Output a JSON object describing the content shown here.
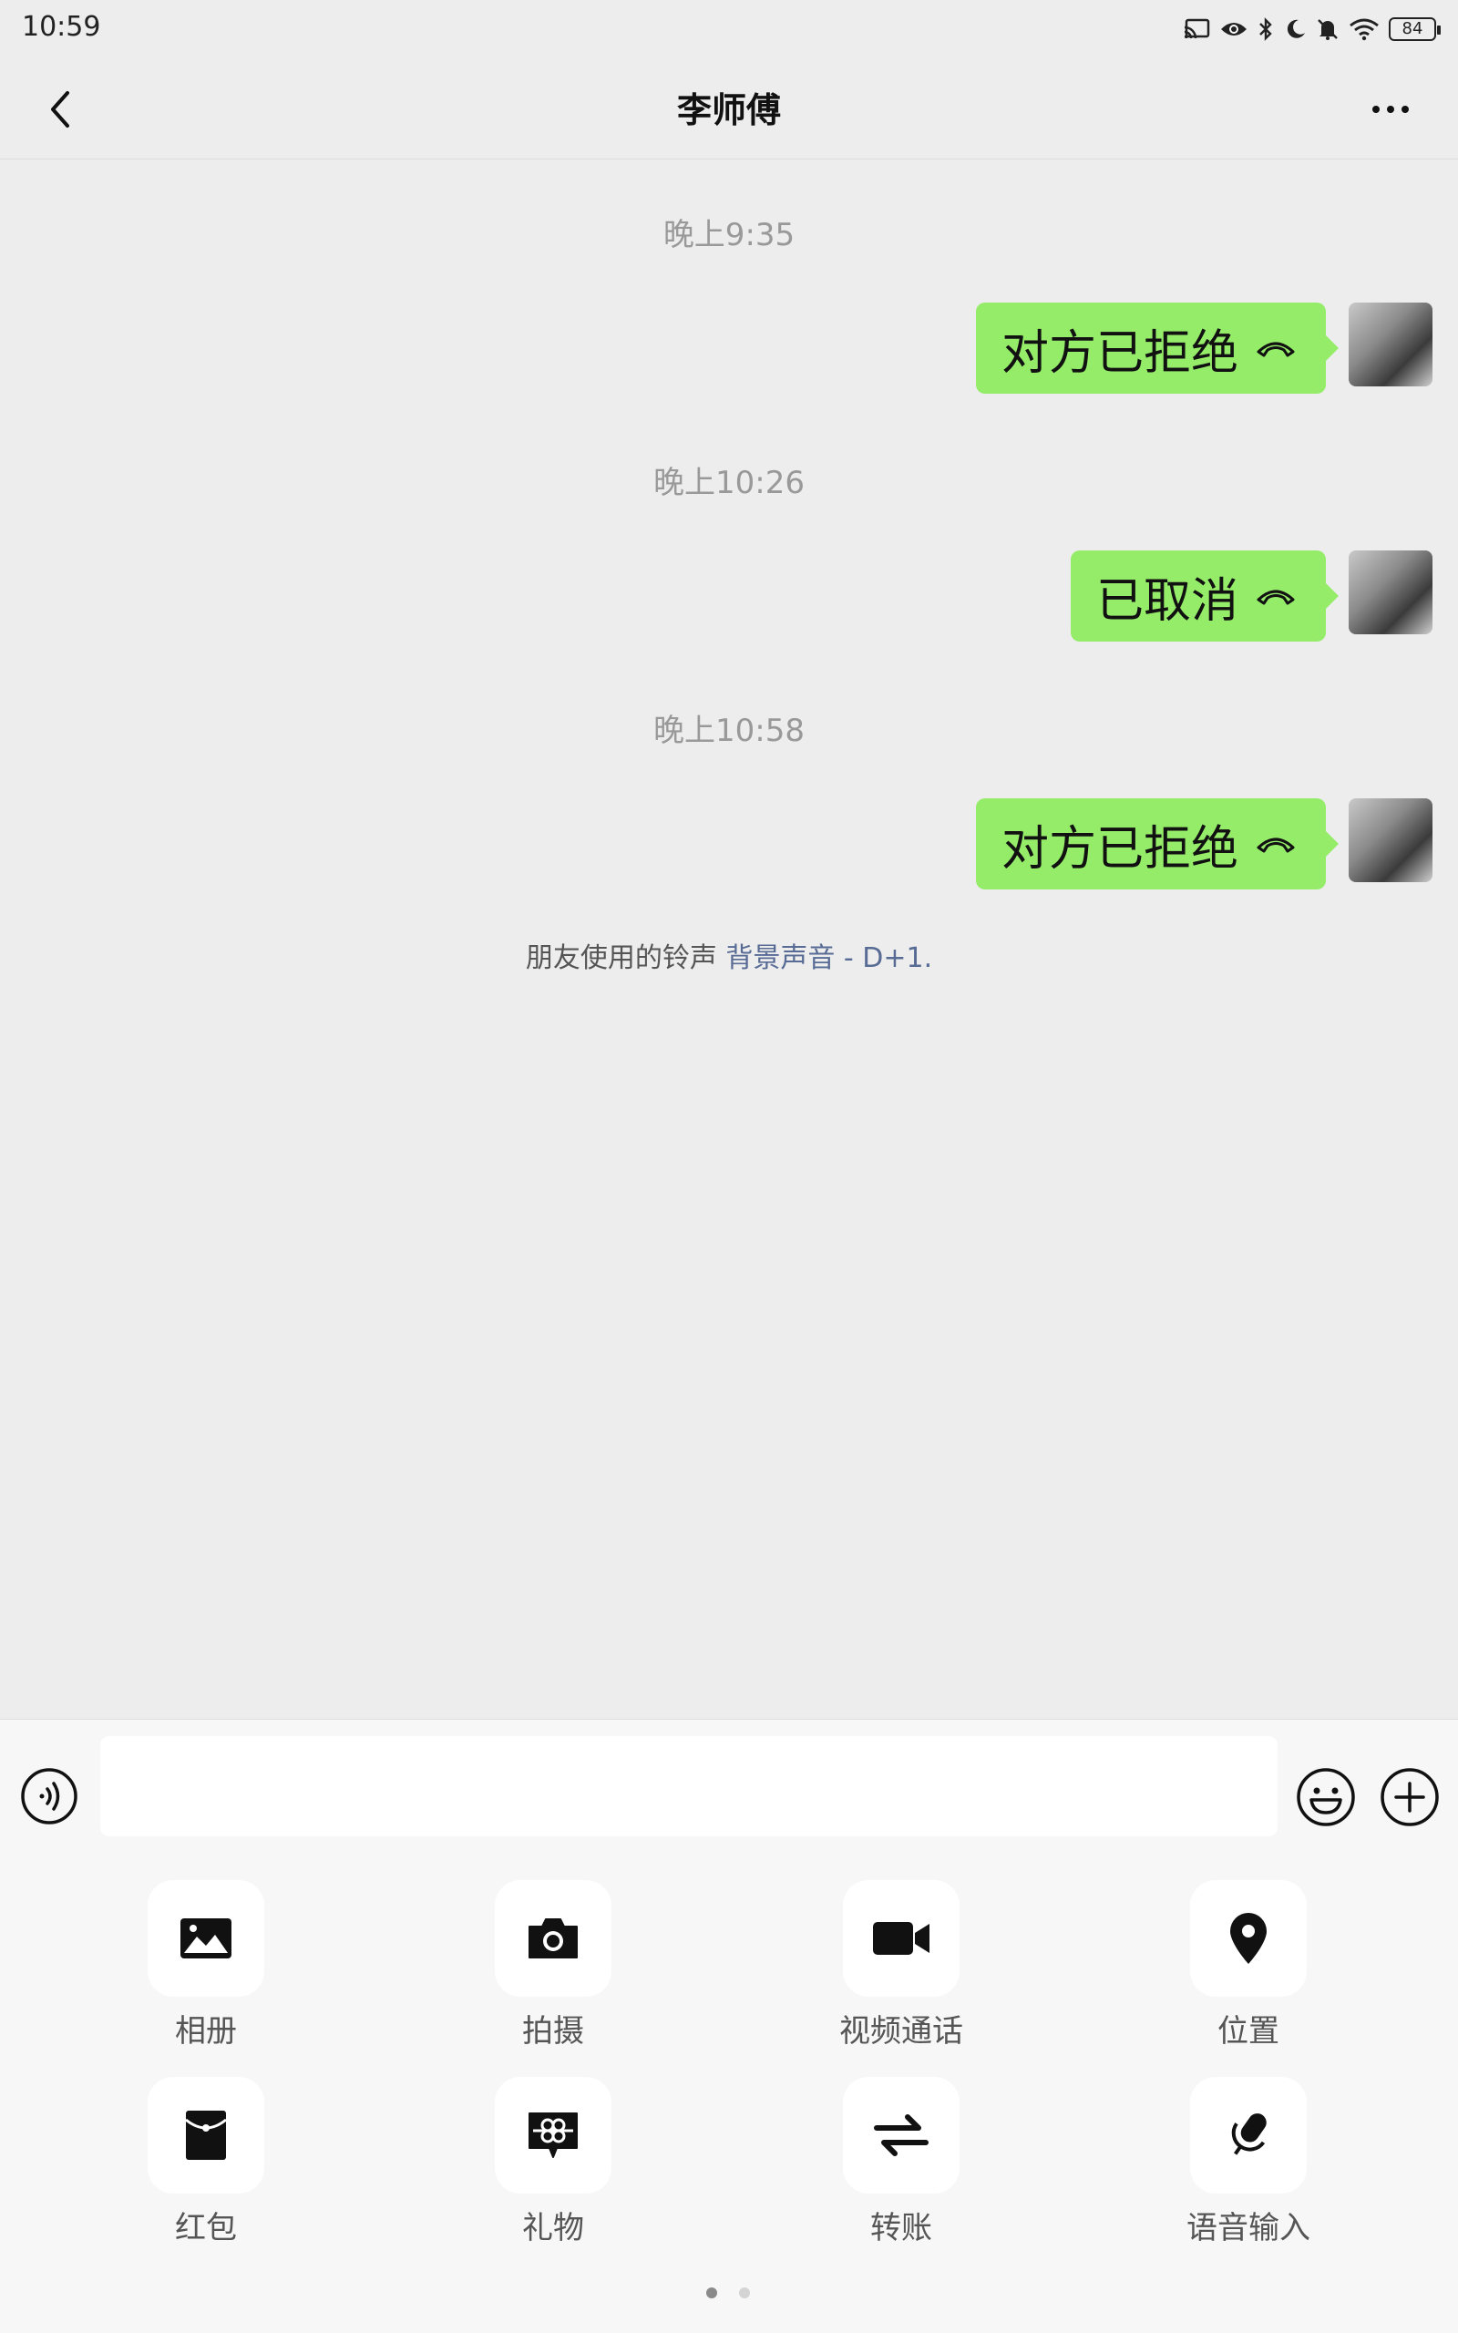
{
  "status_bar": {
    "time": "10:59",
    "battery": "84",
    "icons": [
      "cast-icon",
      "eye-icon",
      "bluetooth-icon",
      "moon-icon",
      "mute-bell-icon",
      "wifi-icon",
      "battery-icon"
    ]
  },
  "header": {
    "title": "李师傅",
    "back_icon": "chevron-left-icon",
    "more_icon": "more-dots-icon"
  },
  "messages": [
    {
      "timestamp": "晚上9:35",
      "text": "对方已拒绝",
      "icon": "hangup-phone-icon"
    },
    {
      "timestamp": "晚上10:26",
      "text": "已取消",
      "icon": "hangup-phone-icon"
    },
    {
      "timestamp": "晚上10:58",
      "text": "对方已拒绝",
      "icon": "hangup-phone-icon"
    }
  ],
  "ringtone_note": {
    "prefix": "朋友使用的铃声",
    "link": "背景声音 - D+1."
  },
  "input_bar": {
    "placeholder": "",
    "icons": [
      "voice-toggle-icon",
      "emoji-icon",
      "plus-icon"
    ]
  },
  "actions": [
    {
      "label": "相册",
      "icon": "image-icon"
    },
    {
      "label": "拍摄",
      "icon": "camera-icon"
    },
    {
      "label": "视频通话",
      "icon": "video-camera-icon"
    },
    {
      "label": "位置",
      "icon": "location-pin-icon"
    },
    {
      "label": "红包",
      "icon": "red-packet-icon"
    },
    {
      "label": "礼物",
      "icon": "gift-icon"
    },
    {
      "label": "转账",
      "icon": "transfer-icon"
    },
    {
      "label": "语音输入",
      "icon": "microphone-icon"
    }
  ],
  "pager": {
    "pages": 2,
    "current_page": 1
  },
  "colors": {
    "bubble_green": "#95ec69",
    "background": "#ededed",
    "link_blue": "#576b95"
  }
}
